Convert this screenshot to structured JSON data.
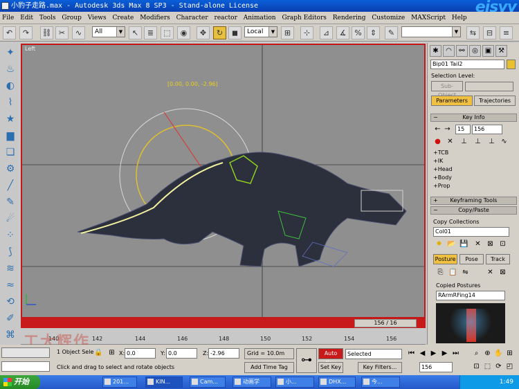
{
  "window": {
    "title": "小豹子走路.max - Autodesk 3ds Max 8 SP3 - Stand-alone License",
    "logo_text": "eisyy"
  },
  "menu": [
    "File",
    "Edit",
    "Tools",
    "Group",
    "Views",
    "Create",
    "Modifiers",
    "Character",
    "reactor",
    "Animation",
    "Graph Editors",
    "Rendering",
    "Customize",
    "MAXScript",
    "Help"
  ],
  "toolbar": {
    "selection_filter": "All",
    "reference_coord": "Local",
    "named_selection": ""
  },
  "viewport": {
    "label": "Left",
    "coord_readout": "[0.00, 0.00, -2.96]"
  },
  "timeline": {
    "frame_display": "156 / 16",
    "ticks": [
      "140",
      "142",
      "144",
      "146",
      "148",
      "150",
      "152",
      "154",
      "156"
    ]
  },
  "command_panel": {
    "object_name": "Bip01 Tail2",
    "selection_level_label": "Selection Level:",
    "sub_object": "Sub-Object",
    "tab_parameters": "Parameters",
    "tab_trajectories": "Trajectories",
    "key_info": {
      "title": "Key Info",
      "key_index": "15",
      "key_frame": "156",
      "items": [
        "+TCB",
        "+IK",
        "+Head",
        "+Body",
        "+Prop"
      ]
    },
    "keyframing_tools": "Keyframing Tools",
    "copy_paste": {
      "title": "Copy/Paste",
      "collections_label": "Copy Collections",
      "collection": "Col01",
      "posture": "Posture",
      "pose": "Pose",
      "track": "Track",
      "copied_postures_label": "Copied Postures",
      "copied_posture": "RArmRFing14"
    }
  },
  "status": {
    "selection_count": "1 Object Sele",
    "prompt": "Click and drag to select and rotate objects",
    "x_label": "X:",
    "x": "0.0",
    "y_label": "Y:",
    "y": "0.0",
    "z_label": "Z:",
    "z": "-2.96",
    "grid": "Grid = 10.0m",
    "add_time_tag": "Add Time Tag",
    "auto_key": "Auto Key",
    "set_key": "Set Key",
    "key_mode": "Selected",
    "key_filters": "Key Filters...",
    "current_frame": "156"
  },
  "taskbar": {
    "start": "开始",
    "tasks": [
      "201...",
      "KIN...",
      "Cam...",
      "动画学",
      "小...",
      "DHX...",
      "今..."
    ],
    "clock": "1:49"
  },
  "watermark_cn": "工大辉作"
}
